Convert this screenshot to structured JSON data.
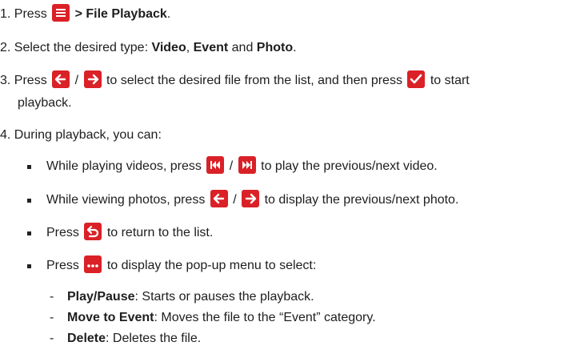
{
  "steps": [
    {
      "num": "1.",
      "pre": "Press",
      "sep": " > ",
      "bold": "File Playback",
      "post": "."
    },
    {
      "num": "2.",
      "pre": "Select the desired type: ",
      "video": "Video",
      "comma": ", ",
      "event": "Event",
      "and": " and ",
      "photo": "Photo",
      "post": "."
    },
    {
      "num": "3.",
      "pre": "Press",
      "slash": "/",
      "mid": "to select the desired file from the list, and then press",
      "post": "to start",
      "cont": "playback."
    },
    {
      "num": "4.",
      "text": "During playback, you can:"
    }
  ],
  "bullets": [
    {
      "pre": "While playing videos, press",
      "slash": "/",
      "post": "to play the previous/next video."
    },
    {
      "pre": "While viewing photos, press",
      "slash": "/",
      "post": "to display the previous/next photo."
    },
    {
      "pre": "Press",
      "post": "to return to the list."
    },
    {
      "pre": "Press",
      "post": "to display the pop-up menu to select:"
    }
  ],
  "subitems": [
    {
      "dash": "-",
      "bold": "Play/Pause",
      "text": ": Starts or pauses the playback."
    },
    {
      "dash": "-",
      "bold": "Move to Event",
      "text": ": Moves the file to the “Event” category."
    },
    {
      "dash": "-",
      "bold": "Delete",
      "text": ": Deletes the file."
    }
  ],
  "icons": {
    "menu": "menu-icon",
    "left": "arrow-left-icon",
    "right": "arrow-right-icon",
    "ok": "checkmark-icon",
    "prev": "previous-track-icon",
    "next": "next-track-icon",
    "back": "back-icon",
    "more": "more-icon",
    "color": "#da2127"
  }
}
